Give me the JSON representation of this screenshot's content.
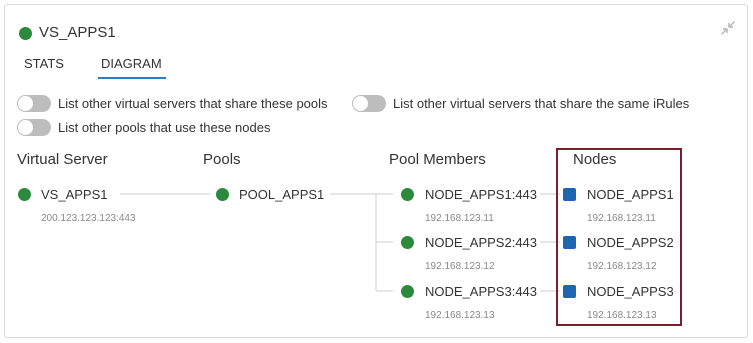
{
  "header": {
    "title": "VS_APPS1",
    "status_color": "#2c8a3c"
  },
  "tabs": [
    {
      "label": "STATS",
      "active": false
    },
    {
      "label": "DIAGRAM",
      "active": true
    }
  ],
  "toggles": [
    {
      "label": "List other virtual servers that share these pools",
      "on": false
    },
    {
      "label": "List other virtual servers that share the same iRules",
      "on": false
    },
    {
      "label": "List other pools that use these nodes",
      "on": false
    }
  ],
  "columns": {
    "virtual_server": "Virtual Server",
    "pools": "Pools",
    "pool_members": "Pool Members",
    "nodes": "Nodes"
  },
  "virtual_server": {
    "name": "VS_APPS1",
    "address": "200.123.123.123:443"
  },
  "pool": {
    "name": "POOL_APPS1"
  },
  "pool_members": [
    {
      "name": "NODE_APPS1:443",
      "address": "192.168.123.11"
    },
    {
      "name": "NODE_APPS2:443",
      "address": "192.168.123.12"
    },
    {
      "name": "NODE_APPS3:443",
      "address": "192.168.123.13"
    }
  ],
  "nodes": [
    {
      "name": "NODE_APPS1",
      "address": "192.168.123.11"
    },
    {
      "name": "NODE_APPS2",
      "address": "192.168.123.12"
    },
    {
      "name": "NODE_APPS3",
      "address": "192.168.123.13"
    }
  ],
  "colors": {
    "available": "#2c8a3c",
    "node": "#1e66b0",
    "tab_accent": "#2a80c8",
    "highlight": "#7a1e2e"
  }
}
